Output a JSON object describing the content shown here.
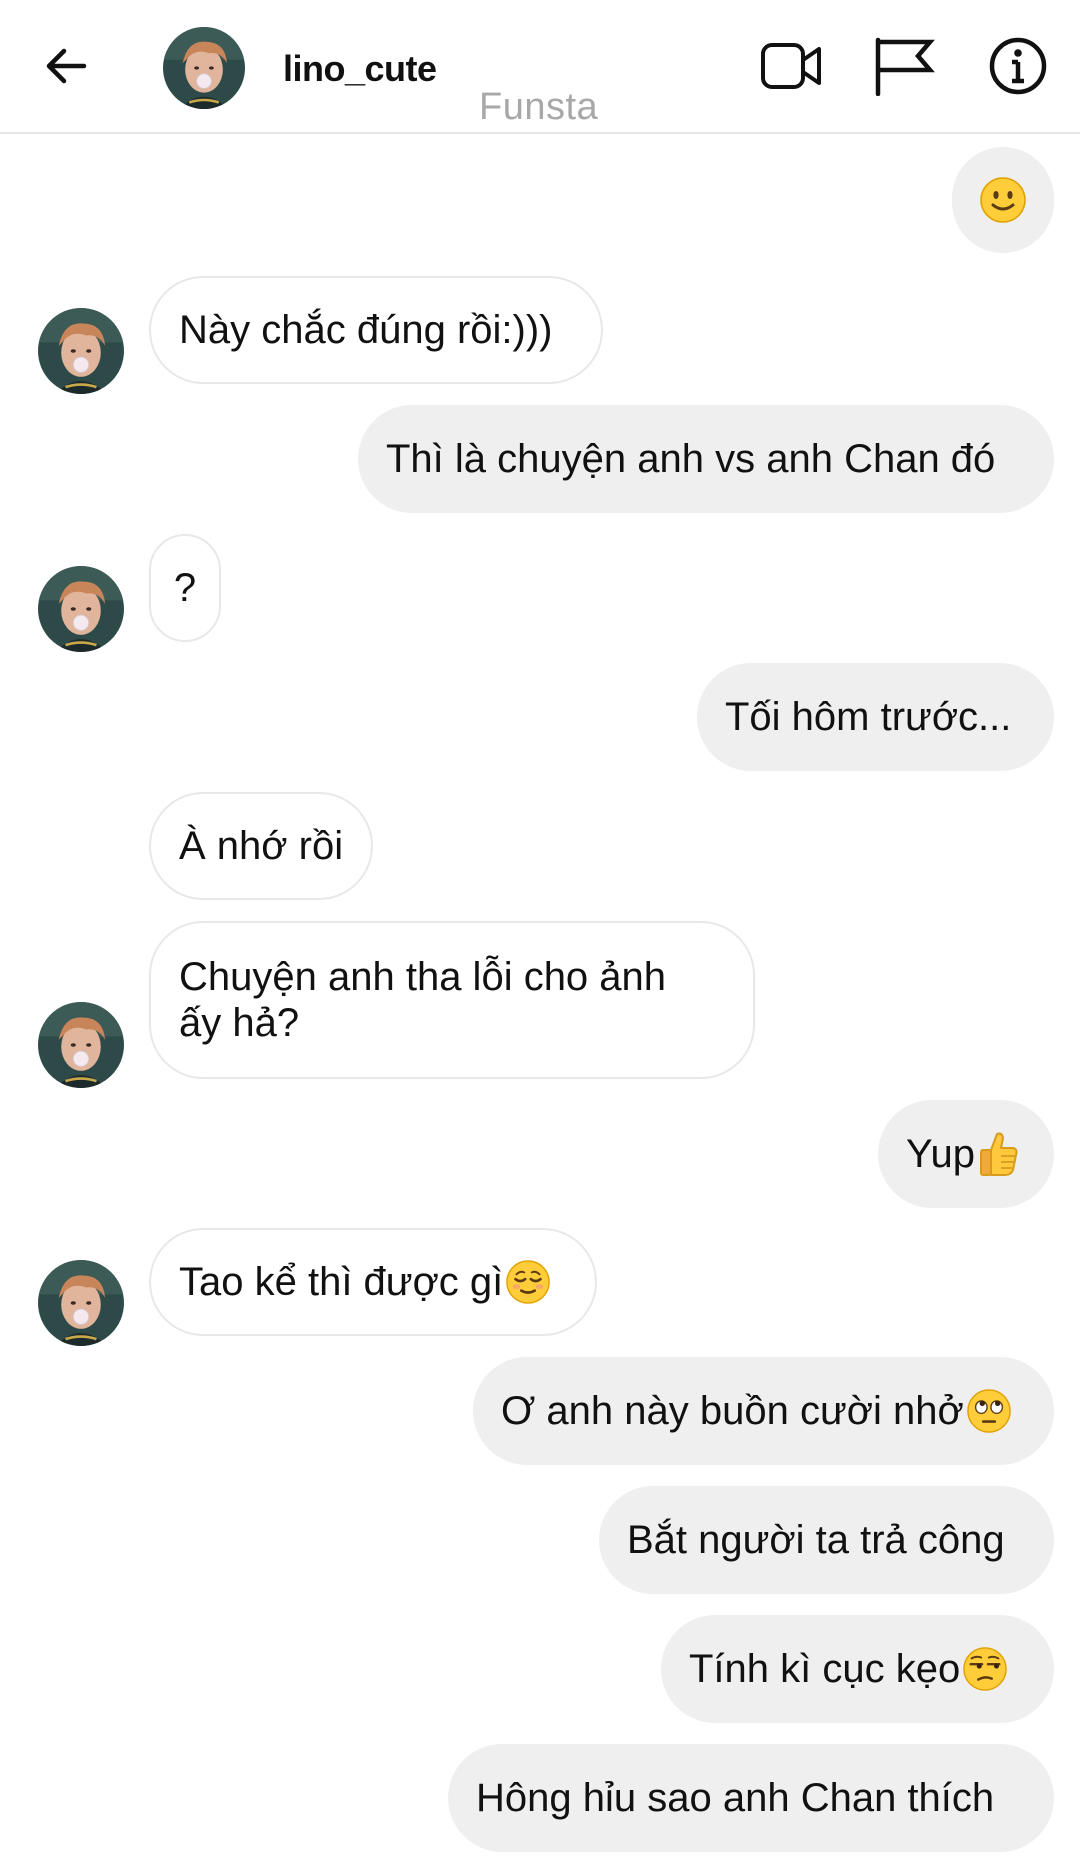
{
  "header": {
    "username": "lino_cute",
    "subtitle": "Funsta"
  },
  "icons": {
    "back": "arrow-left-icon",
    "video": "video-camera-icon",
    "flag": "flag-icon",
    "info": "info-icon"
  },
  "colors": {
    "outgoing_bubble": "#efefef",
    "incoming_bubble_border": "#e8e8e8",
    "subtitle_gray": "#a8a8a8"
  },
  "messages": [
    {
      "side": "out",
      "text": "",
      "emoji": "slightly-smiling-face"
    },
    {
      "side": "in",
      "text": "Này chắc đúng rồi:)))"
    },
    {
      "side": "out",
      "text": "Thì là chuyện anh vs anh Chan đó"
    },
    {
      "side": "in",
      "text": "?"
    },
    {
      "side": "out",
      "text": "Tối hôm trước..."
    },
    {
      "side": "in",
      "text": "À nhớ rồi"
    },
    {
      "side": "in",
      "text": "Chuyện anh tha lỗi cho ảnh ấy hả?"
    },
    {
      "side": "out",
      "text": "Yup",
      "emoji": "thumbs-up"
    },
    {
      "side": "in",
      "text": "Tao kể thì được gì",
      "emoji": "relieved-face"
    },
    {
      "side": "out",
      "text": "Ơ anh này buồn cười nhở",
      "emoji": "face-with-rolling-eyes"
    },
    {
      "side": "out",
      "text": "Bắt người ta trả công"
    },
    {
      "side": "out",
      "text": "Tính kì cục kẹo",
      "emoji": "unamused-face"
    },
    {
      "side": "out",
      "text": "Hông hỉu sao anh Chan thích"
    }
  ]
}
